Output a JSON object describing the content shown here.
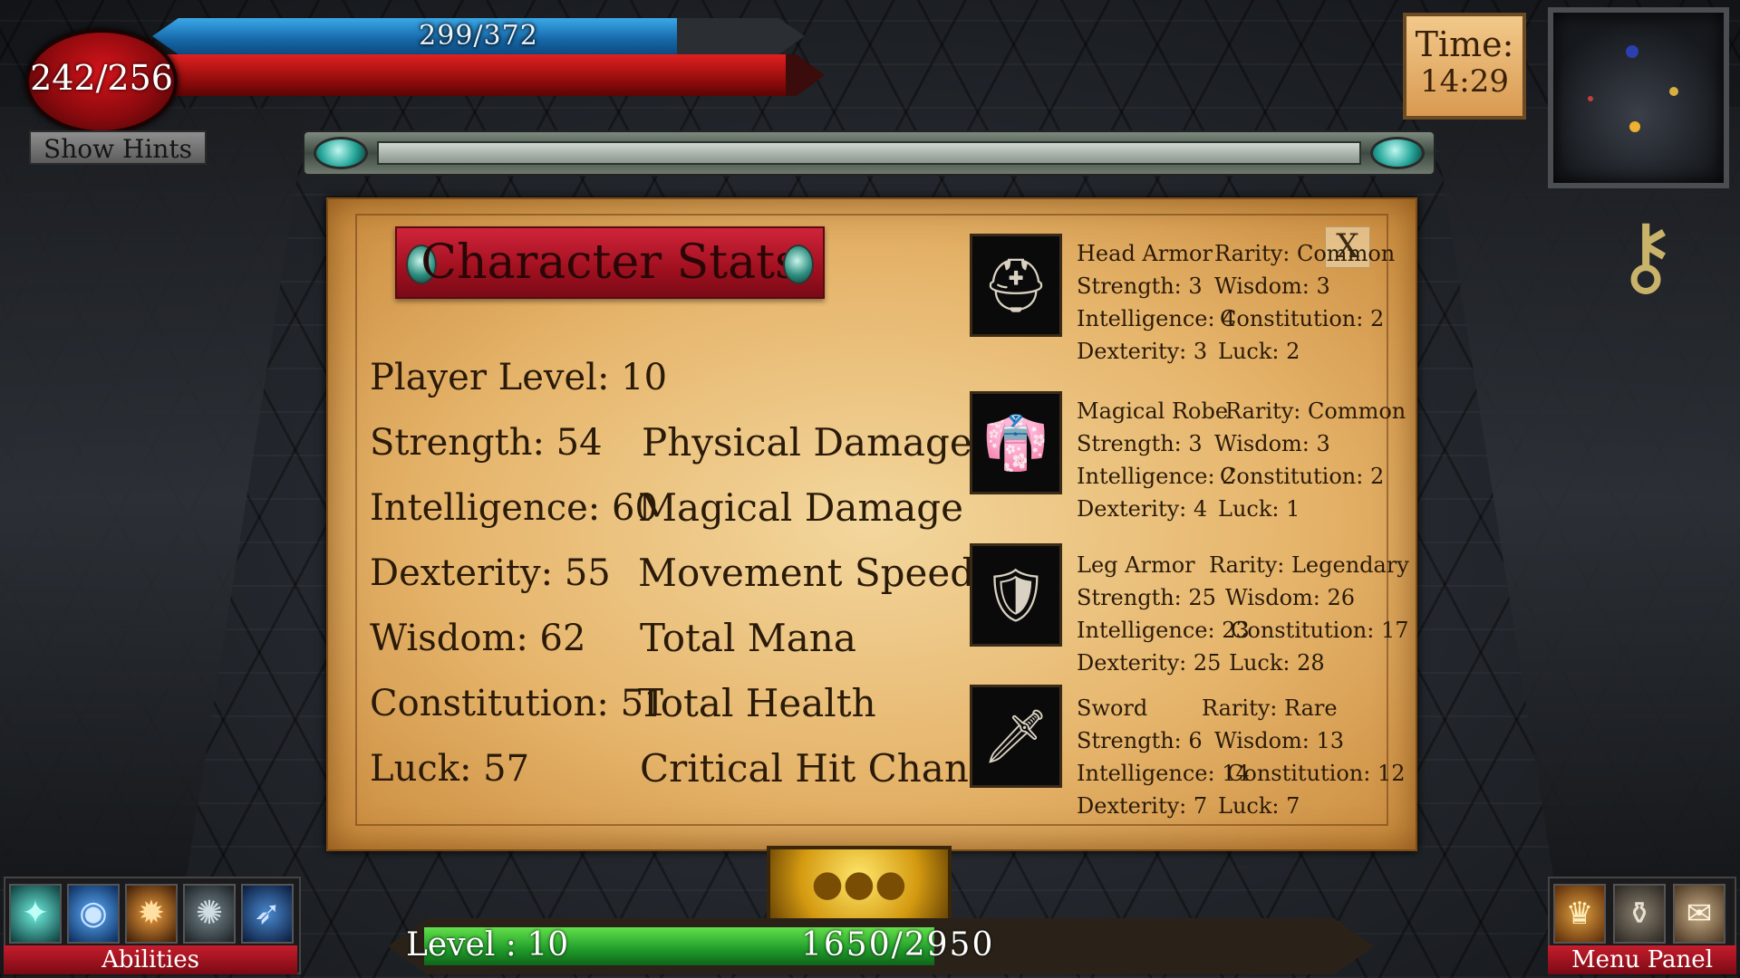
{
  "hud": {
    "mana_text": "299/372",
    "mana_fraction": 0.804,
    "health_text": "242/256",
    "health_fraction": 0.945,
    "hints_label": "Show Hints",
    "time_label": "Time:",
    "time_value": "14:29"
  },
  "panel": {
    "title": "Character Stats",
    "close_label": "X"
  },
  "stats": {
    "player_level": "Player Level: 10",
    "strength": "Strength: 54",
    "intelligence": "Intelligence: 60",
    "dexterity": "Dexterity: 55",
    "wisdom": "Wisdom: 62",
    "constitution": "Constitution: 51",
    "luck": "Luck: 57"
  },
  "derived": {
    "physical_damage": "Physical Damage",
    "magical_damage": "Magical Damage",
    "movement_speed": "Movement Speed",
    "total_mana": "Total Mana",
    "total_health": "Total Health",
    "critical_hit_chance": "Critical Hit Chance"
  },
  "equipment": [
    {
      "name": "Head Armor",
      "rarity": "Rarity: Common",
      "strength": "Strength: 3",
      "wisdom": "Wisdom: 3",
      "intelligence": "Intelligence: 4",
      "constitution": "Constitution: 2",
      "dexterity": "Dexterity: 3",
      "luck": "Luck: 2",
      "icon": "helmet-icon"
    },
    {
      "name": "Magical Robe",
      "rarity": "Rarity: Common",
      "strength": "Strength: 3",
      "wisdom": "Wisdom: 3",
      "intelligence": "Intelligence: 2",
      "constitution": "Constitution: 2",
      "dexterity": "Dexterity: 4",
      "luck": "Luck: 1",
      "icon": "robe-icon"
    },
    {
      "name": "Leg Armor",
      "rarity": "Rarity: Legendary",
      "strength": "Strength: 25",
      "wisdom": "Wisdom: 26",
      "intelligence": "Intelligence: 23",
      "constitution": "Constitution: 17",
      "dexterity": "Dexterity: 25",
      "luck": "Luck: 28",
      "icon": "leg-armor-icon"
    },
    {
      "name": "Sword",
      "rarity": "Rarity: Rare",
      "strength": "Strength: 6",
      "wisdom": "Wisdom: 13",
      "intelligence": "Intelligence: 14",
      "constitution": "Constitution: 12",
      "dexterity": "Dexterity: 7",
      "luck": "Luck: 7",
      "icon": "sword-icon"
    }
  ],
  "bottom": {
    "abilities_label": "Abilities",
    "menu_label": "Menu Panel",
    "level_text": "Level : 10",
    "xp_text": "1650/2950",
    "xp_fraction": 0.559
  },
  "colors": {
    "mana": "#1e7fc4",
    "health": "#c01616",
    "xp": "#2fb03a",
    "parchment": "#e6b56c",
    "banner": "#b0182a"
  }
}
